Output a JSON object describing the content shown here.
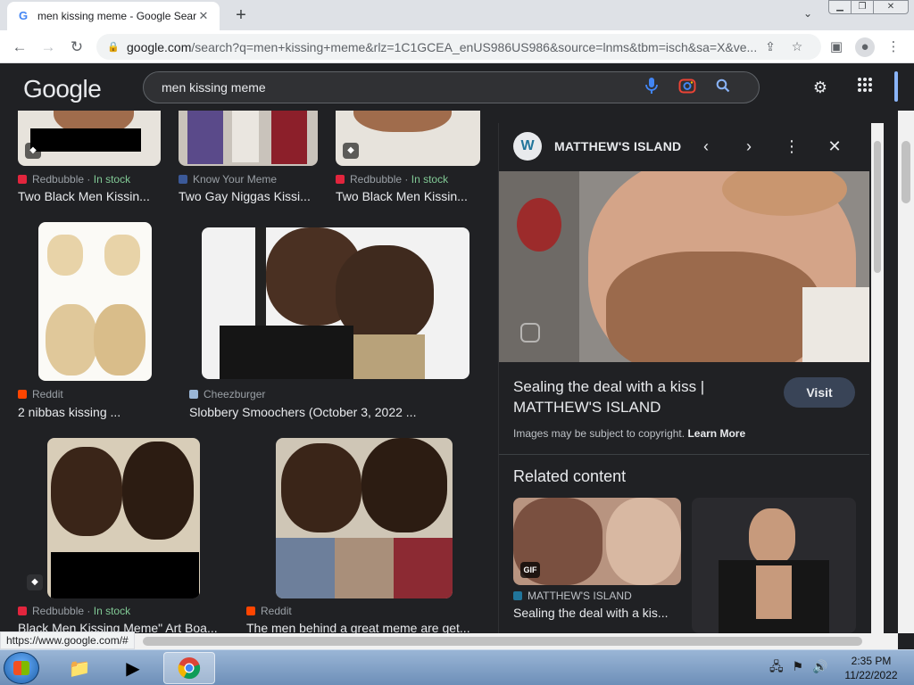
{
  "browser": {
    "tab_title": "men kissing meme - Google Sear",
    "tab_favicon": "G",
    "url_host": "google.com",
    "url_path": "/search?q=men+kissing+meme&rlz=1C1GCEA_enUS986US986&source=lnms&tbm=isch&sa=X&ve...",
    "status_url": "https://www.google.com/#"
  },
  "google": {
    "logo": "Google",
    "query": "men kissing meme"
  },
  "results": [
    {
      "source": "Redbubble",
      "in_stock": "In stock",
      "caption": "Two Black Men Kissin...",
      "source_color": "#e2253d"
    },
    {
      "source": "Know Your Meme",
      "in_stock": "",
      "caption": "Two Gay Niggas Kissi...",
      "source_color": "#3b5998"
    },
    {
      "source": "Redbubble",
      "in_stock": "In stock",
      "caption": "Two Black Men Kissin...",
      "source_color": "#e2253d"
    },
    {
      "source": "Reddit",
      "in_stock": "",
      "caption": "2 nibbas kissing ...",
      "source_color": "#ff4500"
    },
    {
      "source": "Cheezburger",
      "in_stock": "",
      "caption": "Slobbery Smoochers (October 3, 2022 ...",
      "source_color": "#9ab6d6"
    },
    {
      "source": "Redbubble",
      "in_stock": "In stock",
      "caption": "Black Men Kissing Meme\" Art Boa...",
      "source_color": "#e2253d"
    },
    {
      "source": "Reddit",
      "in_stock": "",
      "caption": "The men behind a great meme are get...",
      "source_color": "#ff4500"
    }
  ],
  "panel": {
    "site_name": "MATTHEW'S ISLAND",
    "title": "Sealing the deal with a kiss | MATTHEW'S ISLAND",
    "visit_label": "Visit",
    "copyright": "Images may be subject to copyright.",
    "learn_more": "Learn More",
    "related_heading": "Related content",
    "related_source": "MATTHEW'S ISLAND",
    "related_caption": "Sealing the deal with a kis...",
    "gif_label": "GIF"
  },
  "taskbar": {
    "time": "2:35 PM",
    "date": "11/22/2022"
  },
  "icons": {
    "back": "back-arrow-icon",
    "forward": "forward-arrow-icon",
    "reload": "reload-icon",
    "mic": "microphone-icon",
    "lens": "camera-lens-icon",
    "search": "search-icon",
    "settings": "gear-icon",
    "apps": "apps-grid-icon"
  }
}
